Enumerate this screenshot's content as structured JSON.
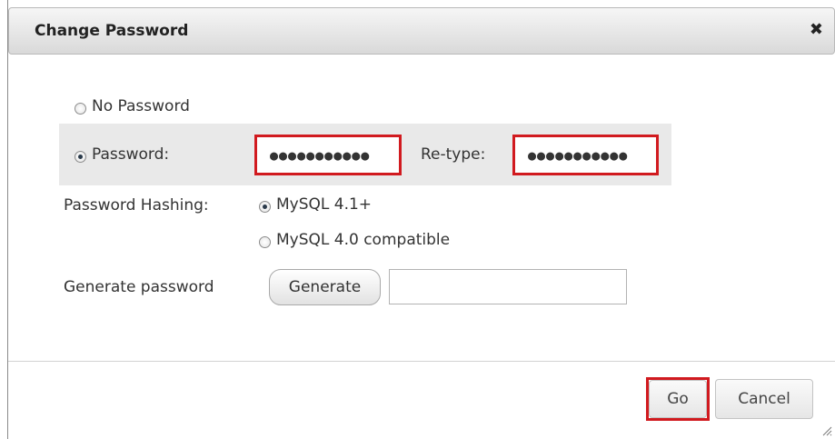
{
  "dialog": {
    "title": "Change Password",
    "close_icon": "close-icon",
    "close_glyph": "✖"
  },
  "options": {
    "no_password_label": "No Password",
    "password_label": "Password:",
    "retype_label": "Re-type:",
    "selected": "password"
  },
  "fields": {
    "password_value": "●●●●●●●●●●●",
    "retype_value": "●●●●●●●●●●●"
  },
  "hashing": {
    "label": "Password Hashing:",
    "options": [
      "MySQL 4.1+",
      "MySQL 4.0 compatible"
    ],
    "selected": "MySQL 4.1+"
  },
  "generate": {
    "label": "Generate password",
    "button_label": "Generate",
    "output_value": ""
  },
  "footer": {
    "go_label": "Go",
    "cancel_label": "Cancel"
  },
  "colors": {
    "highlight": "#d11a1f",
    "band": "#e9e9e9",
    "titlebar": "#e0e0e0"
  }
}
